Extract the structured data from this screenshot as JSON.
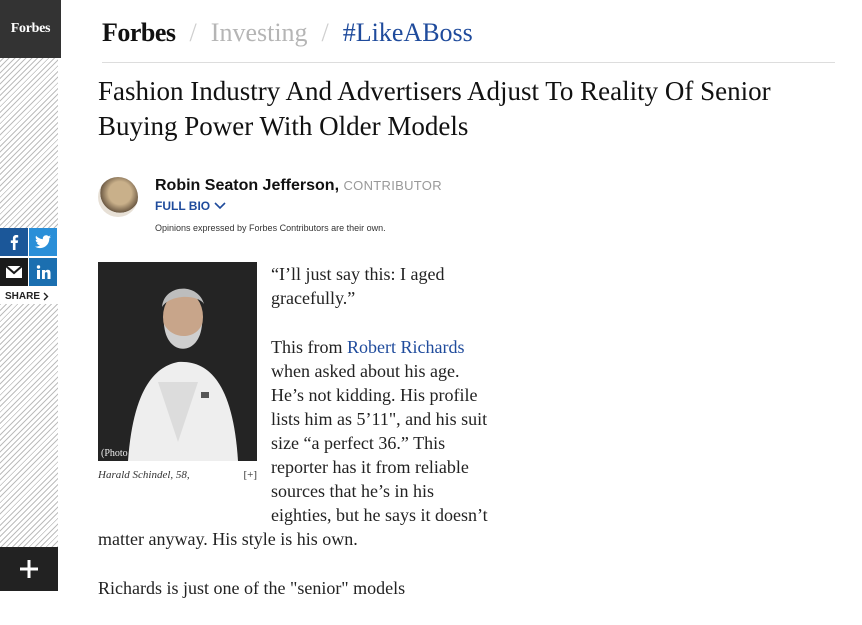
{
  "logo": {
    "text": "Forbes"
  },
  "share": {
    "label": "SHARE"
  },
  "header": {
    "brand": "Forbes",
    "sep1": "/",
    "channel": "Investing",
    "sep2": "/",
    "tag": "#LikeABoss"
  },
  "article": {
    "title": "Fashion Industry And Advertisers Adjust To Reality Of Senior Buying Power With Older Models",
    "author": {
      "name": "Robin Seaton Jefferson",
      "comma": ",",
      "role": "CONTRIBUTOR",
      "full_bio": "FULL BIO",
      "disclaimer": "Opinions expressed by Forbes Contributors are their own."
    },
    "figure": {
      "credit": "(Photo Courtesy of Zandwagon)",
      "caption": "Harald Schindel, 58,",
      "expand": "[+]"
    },
    "paragraphs": {
      "p1": "“I’ll just say this: I aged gracefully.”",
      "p2_before": "This from ",
      "p2_link": "Robert Richards",
      "p2_after": " when asked about his age. He’s not kidding. His profile lists him as 5’11\", and his suit size “a perfect 36.” This reporter has it from reliable sources that he’s in his eighties, but he says it doesn’t matter anyway. His style is his own.",
      "p3": "Richards is just one of the \"senior\" models"
    }
  },
  "colors": {
    "accent": "#1f4b9c",
    "facebook": "#1b5799",
    "twitter": "#2a8fd8",
    "linkedin": "#1b6fb0"
  }
}
